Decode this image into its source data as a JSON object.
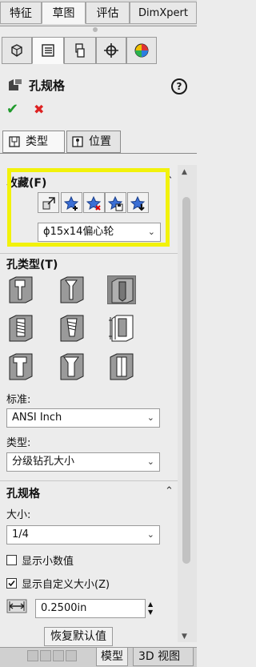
{
  "top_tabs": [
    "特征",
    "草图",
    "评估",
    "DimXpert"
  ],
  "feature_tabs": [
    "feature-manager-icon",
    "property-manager-icon",
    "configuration-manager-icon",
    "dimxpert-manager-icon",
    "display-manager-icon"
  ],
  "header": {
    "title": "孔规格",
    "help": "?",
    "ok": "✔",
    "cancel": "✖"
  },
  "sub_tabs": [
    "类型",
    "位置"
  ],
  "favorites": {
    "title": "收藏(F)",
    "buttons": [
      "apply-defaults-icon",
      "add-favorite-icon",
      "delete-favorite-icon",
      "save-favorite-icon",
      "load-favorite-icon"
    ],
    "selected": "ϕ15x14偏心轮"
  },
  "hole_type": {
    "title": "孔类型(T)",
    "tiles": [
      "counterbore",
      "countersink",
      "hole",
      "straight-tap",
      "tapered-tap",
      "legacy",
      "counterbore-slot",
      "countersink-slot",
      "slot"
    ],
    "active_index": 2,
    "standard_label": "标准:",
    "standard_value": "ANSI Inch",
    "type_label": "类型:",
    "type_value": "分级钻孔大小"
  },
  "hole_spec": {
    "title": "孔规格",
    "size_label": "大小:",
    "size_value": "1/4",
    "show_decimal_label": "显示小数值",
    "show_decimal_checked": false,
    "show_custom_label": "显示自定义大小(Z)",
    "show_custom_checked": true,
    "diameter_value": "0.2500in",
    "restore_label": "恢复默认值"
  },
  "bottom_tabs": [
    "模型",
    "3D 视图"
  ]
}
